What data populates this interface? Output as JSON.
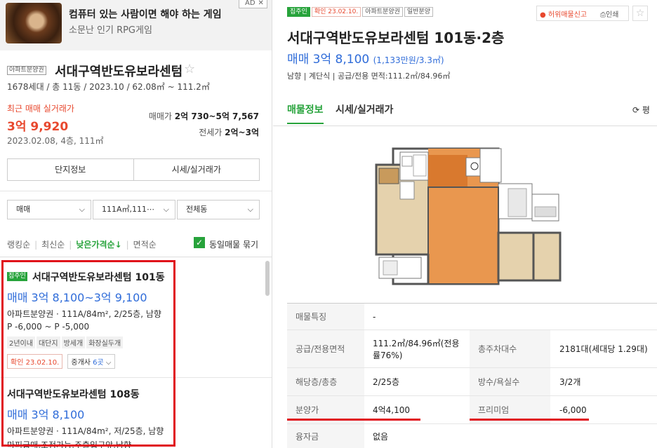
{
  "ad": {
    "title": "컴퓨터 있는 사람이면 해야 하는 게임",
    "subtitle": "소문난 인기 RPG게임",
    "badge": "AD",
    "close": "✕"
  },
  "complex": {
    "tag": "아파트분양권",
    "name": "서대구역반도유보라센텀",
    "meta": "1678세대 / 총 11동 / 2023.10 / 62.08㎡ ~ 111.2㎡",
    "recent_label": "최근 매매 실거래가",
    "recent_price": "3억 9,920",
    "recent_date": "2023.02.08, 4층, 111㎡",
    "trade_label": "매매가",
    "trade_value": "2억 730~5억 7,567",
    "jeonse_label": "전세가",
    "jeonse_value": "2억~3억",
    "btn_info": "단지정보",
    "btn_price": "시세/실거래가"
  },
  "filters": {
    "type": "매매",
    "area": "111A㎡,111⋯",
    "dong": "전체동"
  },
  "sort": {
    "rank": "랭킹순",
    "latest": "최신순",
    "lowprice": "낮은가격순↓",
    "area": "면적순",
    "group_label": "동일매물 묶기"
  },
  "listings": [
    {
      "tag": "집주인",
      "title": "서대구역반도유보라센텀 101동",
      "price": "매매 3억 8,100~3억 9,100",
      "desc": "아파트분양권 · 111A/84m², 2/25층, 남향",
      "desc2": "P -6,000 ~ P -5,000",
      "chips": [
        "2년이내",
        "대단지",
        "방세개",
        "화장실두개"
      ],
      "confirm": "확인 23.02.10.",
      "agency_prefix": "중개사 ",
      "agency_count": "6곳",
      "agency_suffix": " ⌵"
    },
    {
      "title": "서대구역반도유보라센텀 108동",
      "price": "매매 3억 8,100",
      "desc": "아파트분양권 · 111A/84m², 저/25층, 남향",
      "desc2": "마피급매,조정가능,주출입구앞,남향"
    }
  ],
  "detail": {
    "tag_owner": "집주인",
    "tag_confirm": "확인 23.02.10.",
    "tag_type": "아파트분양권",
    "tag_sale": "일반분양",
    "report": "허위매물신고",
    "print": "인쇄",
    "title": "서대구역반도유보라센텀 101동·2층",
    "price": "매매 3억 8,100",
    "price_sub": "(1,133만원/3.3㎡)",
    "attrs": "남향 | 계단식 | 공급/전용 면적:111.2㎡/84.96㎡",
    "tab_info": "매물정보",
    "tab_price": "시세/실거래가",
    "refresh": "⟳ 평",
    "table": [
      {
        "k1": "매물특징",
        "v1": "-",
        "k2": "",
        "v2": ""
      },
      {
        "k1": "공급/전용면적",
        "v1": "111.2㎡/84.96㎡(전용률76%)",
        "k2": "총주차대수",
        "v2": "2181대(세대당 1.29대)"
      },
      {
        "k1": "해당층/총층",
        "v1": "2/25층",
        "k2": "방수/욕실수",
        "v2": "3/2개"
      },
      {
        "k1": "분양가",
        "v1": "4억4,100",
        "k2": "프리미엄",
        "v2": "-6,000"
      },
      {
        "k1": "융자금",
        "v1": "없음",
        "k2": "",
        "v2": ""
      }
    ]
  },
  "colors": {
    "accent_green": "#27a33b",
    "price_blue": "#2f6cd9",
    "alert_red": "#e8482e",
    "highlight_red": "#e0101a"
  }
}
